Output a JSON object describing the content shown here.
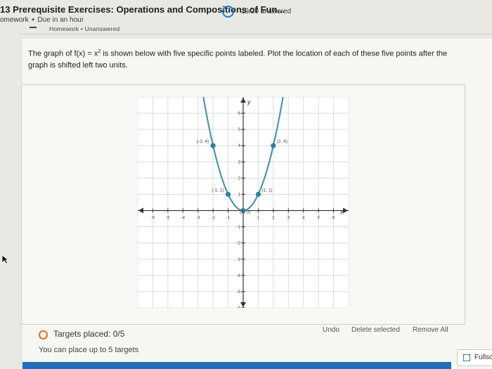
{
  "header": {
    "title": "13 Prerequisite Exercises: Operations and Compositions of Fun...",
    "answered": "19/20 answered",
    "course": "omework",
    "due": "Due in an hour",
    "strip_text": "Homework • Unanswered"
  },
  "question": {
    "prefix": "The graph of",
    "func": "f(x) = x",
    "exponent": "2",
    "suffix": "is shown below with five specific points labeled. Plot the location of each of these five points after the graph is shifted left two units."
  },
  "chart_data": {
    "type": "line",
    "function": "y = x^2",
    "axis_label_x": "x",
    "axis_label_y": "y",
    "xlim": [
      -7,
      7
    ],
    "ylim": [
      -6,
      7
    ],
    "x_ticks": [
      -6,
      -5,
      -4,
      -3,
      -2,
      -1,
      1,
      2,
      3,
      4,
      5,
      6
    ],
    "x_tick_labels": [
      "-6",
      "-5",
      "-4",
      "-3",
      "-2",
      "-1",
      "1",
      "2",
      "3",
      "4",
      "5",
      "6"
    ],
    "y_ticks": [
      -6,
      -5,
      -4,
      -3,
      -2,
      -1,
      1,
      2,
      3,
      4,
      5,
      6
    ],
    "y_tick_labels": [
      "-6",
      "-5",
      "-4",
      "-3",
      "-2",
      "-1",
      "1",
      "2",
      "3",
      "4",
      "5",
      "6"
    ],
    "grid": true,
    "curve_color": "#3b8fb0",
    "point_color": "#2b7fae",
    "points": [
      {
        "x": -2,
        "y": 4,
        "label": "(-2, 4)"
      },
      {
        "x": -1,
        "y": 1,
        "label": "(-1, 1)"
      },
      {
        "x": 0,
        "y": 0,
        "label": "(0, 0)"
      },
      {
        "x": 1,
        "y": 1,
        "label": "(1, 1)"
      },
      {
        "x": 2,
        "y": 4,
        "label": "(2, 4)"
      }
    ]
  },
  "footer": {
    "targets_placed": "Targets placed: 0/5",
    "limit": "You can place up to 5 targets",
    "undo": "Undo",
    "delete_selected": "Delete selected",
    "remove_all": "Remove All",
    "fullscreen": "Fullsc"
  }
}
